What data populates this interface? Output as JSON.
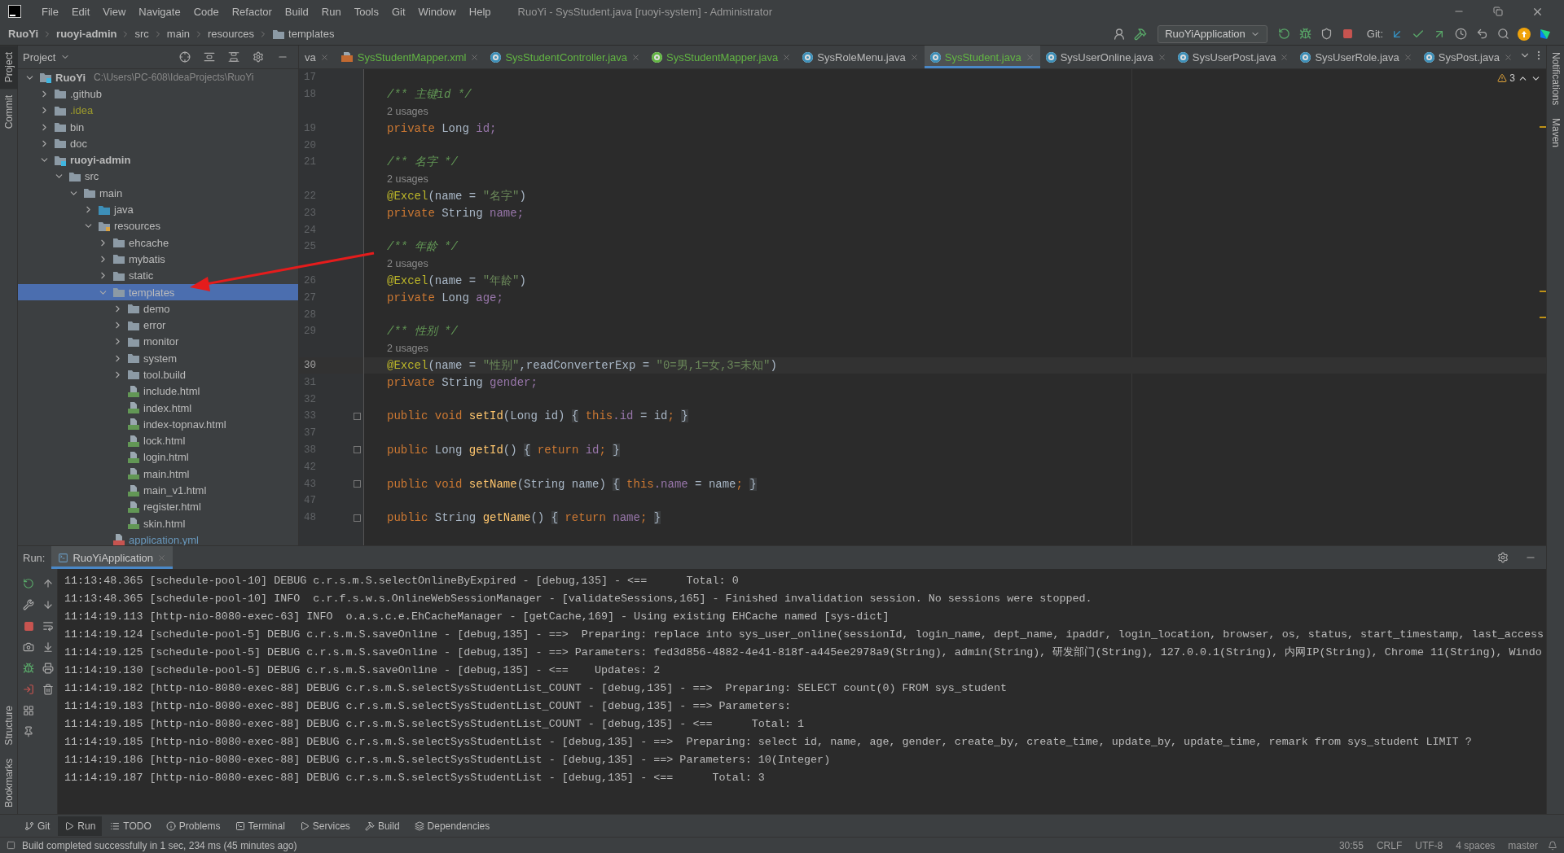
{
  "menu": [
    "File",
    "Edit",
    "View",
    "Navigate",
    "Code",
    "Refactor",
    "Build",
    "Run",
    "Tools",
    "Git",
    "Window",
    "Help"
  ],
  "window_title": "RuoYi - SysStudent.java [ruoyi-system] - Administrator",
  "breadcrumbs": [
    {
      "label": "RuoYi",
      "bold": true,
      "icon": false
    },
    {
      "label": "ruoyi-admin",
      "bold": true,
      "icon": false
    },
    {
      "label": "src",
      "bold": false,
      "icon": false
    },
    {
      "label": "main",
      "bold": false,
      "icon": false
    },
    {
      "label": "resources",
      "bold": false,
      "icon": false
    },
    {
      "label": "templates",
      "bold": false,
      "icon": true
    }
  ],
  "toolbar": {
    "run_config": "RuoYiApplication",
    "git_label": "Git:"
  },
  "left_stripe": {
    "top": [
      {
        "label": "Project",
        "selected": true
      },
      {
        "label": "Commit",
        "selected": false
      }
    ],
    "bottom": [
      {
        "label": "Structure",
        "selected": false
      },
      {
        "label": "Bookmarks",
        "selected": false
      }
    ]
  },
  "right_stripe": [
    "Notifications",
    "Maven"
  ],
  "project": {
    "title": "Project",
    "tree": [
      {
        "label": "RuoYi",
        "kind": "module",
        "path": "C:\\Users\\PC-608\\IdeaProjects\\RuoYi",
        "selected": false,
        "expanded": true,
        "children": [
          {
            "label": ".github",
            "kind": "folder",
            "selected": false,
            "expanded": false
          },
          {
            "label": ".idea",
            "kind": "folder",
            "color": "#9c9a2c",
            "selected": false,
            "expanded": false
          },
          {
            "label": "bin",
            "kind": "folder",
            "selected": false,
            "expanded": false
          },
          {
            "label": "doc",
            "kind": "folder",
            "selected": false,
            "expanded": false
          },
          {
            "label": "ruoyi-admin",
            "kind": "module",
            "selected": false,
            "expanded": true,
            "children": [
              {
                "label": "src",
                "kind": "folder",
                "selected": false,
                "expanded": true,
                "children": [
                  {
                    "label": "main",
                    "kind": "folder",
                    "selected": false,
                    "expanded": true,
                    "children": [
                      {
                        "label": "java",
                        "kind": "source",
                        "selected": false,
                        "expanded": false
                      },
                      {
                        "label": "resources",
                        "kind": "resources",
                        "selected": false,
                        "expanded": true,
                        "children": [
                          {
                            "label": "ehcache",
                            "kind": "folder",
                            "selected": false,
                            "expanded": false
                          },
                          {
                            "label": "mybatis",
                            "kind": "folder",
                            "selected": false,
                            "expanded": false
                          },
                          {
                            "label": "static",
                            "kind": "folder",
                            "selected": false,
                            "expanded": false
                          },
                          {
                            "label": "templates",
                            "kind": "folder",
                            "selected": true,
                            "expanded": true,
                            "children": [
                              {
                                "label": "demo",
                                "kind": "folder",
                                "selected": false,
                                "expanded": false
                              },
                              {
                                "label": "error",
                                "kind": "folder",
                                "selected": false,
                                "expanded": false
                              },
                              {
                                "label": "monitor",
                                "kind": "folder",
                                "selected": false,
                                "expanded": false
                              },
                              {
                                "label": "system",
                                "kind": "folder",
                                "selected": false,
                                "expanded": false
                              },
                              {
                                "label": "tool.build",
                                "kind": "folder",
                                "selected": false,
                                "expanded": false
                              },
                              {
                                "label": "include.html",
                                "kind": "html",
                                "selected": false
                              },
                              {
                                "label": "index.html",
                                "kind": "html",
                                "selected": false
                              },
                              {
                                "label": "index-topnav.html",
                                "kind": "html",
                                "selected": false
                              },
                              {
                                "label": "lock.html",
                                "kind": "html",
                                "selected": false
                              },
                              {
                                "label": "login.html",
                                "kind": "html",
                                "selected": false
                              },
                              {
                                "label": "main.html",
                                "kind": "html",
                                "selected": false
                              },
                              {
                                "label": "main_v1.html",
                                "kind": "html",
                                "selected": false
                              },
                              {
                                "label": "register.html",
                                "kind": "html",
                                "selected": false
                              },
                              {
                                "label": "skin.html",
                                "kind": "html",
                                "selected": false
                              }
                            ]
                          },
                          {
                            "label": "application.yml",
                            "kind": "yml",
                            "color": "#6897bb",
                            "selected": false
                          }
                        ]
                      }
                    ]
                  }
                ]
              }
            ]
          }
        ]
      }
    ]
  },
  "editor_tabs": [
    {
      "label": "va",
      "added": false,
      "selected": false
    },
    {
      "label": "SysStudentMapper.xml",
      "kind": "xml",
      "added": true,
      "selected": false
    },
    {
      "label": "SysStudentController.java",
      "kind": "class",
      "added": true,
      "selected": false
    },
    {
      "label": "SysStudentMapper.java",
      "kind": "interface",
      "added": true,
      "selected": false
    },
    {
      "label": "SysRoleMenu.java",
      "kind": "class",
      "added": false,
      "selected": false
    },
    {
      "label": "SysStudent.java",
      "kind": "class",
      "added": true,
      "selected": true
    },
    {
      "label": "SysUserOnline.java",
      "kind": "class",
      "added": false,
      "selected": false
    },
    {
      "label": "SysUserPost.java",
      "kind": "class",
      "added": false,
      "selected": false
    },
    {
      "label": "SysUserRole.java",
      "kind": "class",
      "added": false,
      "selected": false
    },
    {
      "label": "SysPost.java",
      "kind": "class",
      "added": false,
      "selected": false
    }
  ],
  "editor": {
    "warnings": "3",
    "lines": [
      {
        "kind": "code",
        "num": "17",
        "current": false,
        "foldable": false
      },
      {
        "kind": "code",
        "num": "18",
        "current": false,
        "foldable": false,
        "tokens": [
          {
            "t": "/** 主键id */",
            "kind": "doc"
          }
        ]
      },
      {
        "kind": "hint",
        "text": "2 usages"
      },
      {
        "kind": "code",
        "num": "19",
        "current": false,
        "foldable": false,
        "tokens": [
          {
            "t": "private ",
            "kind": "kw"
          },
          {
            "t": "Long ",
            "kind": "plain"
          },
          {
            "t": "id;",
            "kind": "field"
          }
        ]
      },
      {
        "kind": "code",
        "num": "20",
        "current": false,
        "foldable": false
      },
      {
        "kind": "code",
        "num": "21",
        "current": false,
        "foldable": false,
        "tokens": [
          {
            "t": "/** 名字 */",
            "kind": "doc"
          }
        ]
      },
      {
        "kind": "hint",
        "text": "2 usages"
      },
      {
        "kind": "code",
        "num": "22",
        "current": false,
        "foldable": false,
        "tokens": [
          {
            "t": "@Excel",
            "kind": "ann"
          },
          {
            "t": "(name = ",
            "kind": "plain"
          },
          {
            "t": "\"名字\"",
            "kind": "str"
          },
          {
            "t": ")",
            "kind": "plain"
          }
        ]
      },
      {
        "kind": "code",
        "num": "23",
        "current": false,
        "foldable": false,
        "tokens": [
          {
            "t": "private ",
            "kind": "kw"
          },
          {
            "t": "String ",
            "kind": "plain"
          },
          {
            "t": "name;",
            "kind": "field"
          }
        ]
      },
      {
        "kind": "code",
        "num": "24",
        "current": false,
        "foldable": false
      },
      {
        "kind": "code",
        "num": "25",
        "current": false,
        "foldable": false,
        "tokens": [
          {
            "t": "/** 年龄 */",
            "kind": "doc"
          }
        ]
      },
      {
        "kind": "hint",
        "text": "2 usages"
      },
      {
        "kind": "code",
        "num": "26",
        "current": false,
        "foldable": false,
        "tokens": [
          {
            "t": "@Excel",
            "kind": "ann"
          },
          {
            "t": "(name = ",
            "kind": "plain"
          },
          {
            "t": "\"年龄\"",
            "kind": "str"
          },
          {
            "t": ")",
            "kind": "plain"
          }
        ]
      },
      {
        "kind": "code",
        "num": "27",
        "current": false,
        "foldable": false,
        "tokens": [
          {
            "t": "private ",
            "kind": "kw"
          },
          {
            "t": "Long ",
            "kind": "plain"
          },
          {
            "t": "age;",
            "kind": "field"
          }
        ]
      },
      {
        "kind": "code",
        "num": "28",
        "current": false,
        "foldable": false
      },
      {
        "kind": "code",
        "num": "29",
        "current": false,
        "foldable": false,
        "tokens": [
          {
            "t": "/** 性别 */",
            "kind": "doc"
          }
        ]
      },
      {
        "kind": "hint",
        "text": "2 usages"
      },
      {
        "kind": "code",
        "num": "30",
        "current": true,
        "foldable": false,
        "tokens": [
          {
            "t": "@Excel",
            "kind": "ann"
          },
          {
            "t": "(name = ",
            "kind": "plain"
          },
          {
            "t": "\"性别\"",
            "kind": "str"
          },
          {
            "t": ",readConverterExp = ",
            "kind": "plain"
          },
          {
            "t": "\"0=男,1=女,3=未知\"",
            "kind": "str"
          },
          {
            "t": ")",
            "kind": "plain"
          }
        ]
      },
      {
        "kind": "code",
        "num": "31",
        "current": false,
        "foldable": false,
        "tokens": [
          {
            "t": "private ",
            "kind": "kw"
          },
          {
            "t": "String ",
            "kind": "plain"
          },
          {
            "t": "gender;",
            "kind": "field"
          }
        ]
      },
      {
        "kind": "code",
        "num": "32",
        "current": false,
        "foldable": false
      },
      {
        "kind": "code",
        "num": "33",
        "current": false,
        "foldable": true,
        "tokens": [
          {
            "t": "public void ",
            "kind": "kw"
          },
          {
            "t": "setId",
            "kind": "method"
          },
          {
            "t": "(Long id) ",
            "kind": "plain"
          },
          {
            "t": "{",
            "kind": "fold"
          },
          {
            "t": " this",
            "kind": "kw"
          },
          {
            "t": ".id",
            "kind": "field"
          },
          {
            "t": " = id",
            "kind": "plain"
          },
          {
            "t": "; ",
            "kind": "kw"
          },
          {
            "t": "}",
            "kind": "fold"
          }
        ]
      },
      {
        "kind": "code",
        "num": "37",
        "current": false,
        "foldable": false
      },
      {
        "kind": "code",
        "num": "38",
        "current": false,
        "foldable": true,
        "tokens": [
          {
            "t": "public ",
            "kind": "kw"
          },
          {
            "t": "Long ",
            "kind": "plain"
          },
          {
            "t": "getId",
            "kind": "method"
          },
          {
            "t": "() ",
            "kind": "plain"
          },
          {
            "t": "{",
            "kind": "fold"
          },
          {
            "t": " return ",
            "kind": "kw"
          },
          {
            "t": "id",
            "kind": "field"
          },
          {
            "t": "; ",
            "kind": "kw"
          },
          {
            "t": "}",
            "kind": "fold"
          }
        ]
      },
      {
        "kind": "code",
        "num": "42",
        "current": false,
        "foldable": false
      },
      {
        "kind": "code",
        "num": "43",
        "current": false,
        "foldable": true,
        "tokens": [
          {
            "t": "public void ",
            "kind": "kw"
          },
          {
            "t": "setName",
            "kind": "method"
          },
          {
            "t": "(String name) ",
            "kind": "plain"
          },
          {
            "t": "{",
            "kind": "fold"
          },
          {
            "t": " this",
            "kind": "kw"
          },
          {
            "t": ".name",
            "kind": "field"
          },
          {
            "t": " = name",
            "kind": "plain"
          },
          {
            "t": "; ",
            "kind": "kw"
          },
          {
            "t": "}",
            "kind": "fold"
          }
        ]
      },
      {
        "kind": "code",
        "num": "47",
        "current": false,
        "foldable": false
      },
      {
        "kind": "code",
        "num": "48",
        "current": false,
        "foldable": true,
        "tokens": [
          {
            "t": "public ",
            "kind": "kw"
          },
          {
            "t": "String ",
            "kind": "plain"
          },
          {
            "t": "getName",
            "kind": "method"
          },
          {
            "t": "() ",
            "kind": "plain"
          },
          {
            "t": "{",
            "kind": "fold"
          },
          {
            "t": " return ",
            "kind": "kw"
          },
          {
            "t": "name",
            "kind": "field"
          },
          {
            "t": "; ",
            "kind": "kw"
          },
          {
            "t": "}",
            "kind": "fold"
          }
        ]
      }
    ]
  },
  "run": {
    "label": "Run:",
    "tab": "RuoYiApplication",
    "log": [
      "11:13:48.365 [schedule-pool-10] DEBUG c.r.s.m.S.selectOnlineByExpired - [debug,135] - <==      Total: 0",
      "11:13:48.365 [schedule-pool-10] INFO  c.r.f.s.w.s.OnlineWebSessionManager - [validateSessions,165] - Finished invalidation session. No sessions were stopped.",
      "11:14:19.113 [http-nio-8080-exec-63] INFO  o.a.s.c.e.EhCacheManager - [getCache,169] - Using existing EHCache named [sys-dict]",
      "11:14:19.124 [schedule-pool-5] DEBUG c.r.s.m.S.saveOnline - [debug,135] - ==>  Preparing: replace into sys_user_online(sessionId, login_name, dept_name, ipaddr, login_location, browser, os, status, start_timestamp, last_access",
      "11:14:19.125 [schedule-pool-5] DEBUG c.r.s.m.S.saveOnline - [debug,135] - ==> Parameters: fed3d856-4882-4e41-818f-a445ee2978a9(String), admin(String), 研发部门(String), 127.0.0.1(String), 内网IP(String), Chrome 11(String), Windo",
      "11:14:19.130 [schedule-pool-5] DEBUG c.r.s.m.S.saveOnline - [debug,135] - <==    Updates: 2",
      "11:14:19.182 [http-nio-8080-exec-88] DEBUG c.r.s.m.S.selectSysStudentList_COUNT - [debug,135] - ==>  Preparing: SELECT count(0) FROM sys_student",
      "11:14:19.183 [http-nio-8080-exec-88] DEBUG c.r.s.m.S.selectSysStudentList_COUNT - [debug,135] - ==> Parameters:",
      "11:14:19.185 [http-nio-8080-exec-88] DEBUG c.r.s.m.S.selectSysStudentList_COUNT - [debug,135] - <==      Total: 1",
      "11:14:19.185 [http-nio-8080-exec-88] DEBUG c.r.s.m.S.selectSysStudentList - [debug,135] - ==>  Preparing: select id, name, age, gender, create_by, create_time, update_by, update_time, remark from sys_student LIMIT ?",
      "11:14:19.186 [http-nio-8080-exec-88] DEBUG c.r.s.m.S.selectSysStudentList - [debug,135] - ==> Parameters: 10(Integer)",
      "11:14:19.187 [http-nio-8080-exec-88] DEBUG c.r.s.m.S.selectSysStudentList - [debug,135] - <==      Total: 3"
    ]
  },
  "tool_windows": [
    {
      "label": "Git",
      "kind": "git",
      "selected": false
    },
    {
      "label": "Run",
      "kind": "run",
      "selected": true
    },
    {
      "label": "TODO",
      "kind": "list",
      "selected": false
    },
    {
      "label": "Problems",
      "kind": "info",
      "selected": false
    },
    {
      "label": "Terminal",
      "kind": "terminal",
      "selected": false
    },
    {
      "label": "Services",
      "kind": "play",
      "selected": false
    },
    {
      "label": "Build",
      "kind": "hammer",
      "selected": false
    },
    {
      "label": "Dependencies",
      "kind": "layers",
      "selected": false
    }
  ],
  "status": {
    "message": "Build completed successfully in 1 sec, 234 ms (45 minutes ago)",
    "items": [
      "30:55",
      "CRLF",
      "UTF-8",
      "4 spaces",
      "master"
    ]
  }
}
